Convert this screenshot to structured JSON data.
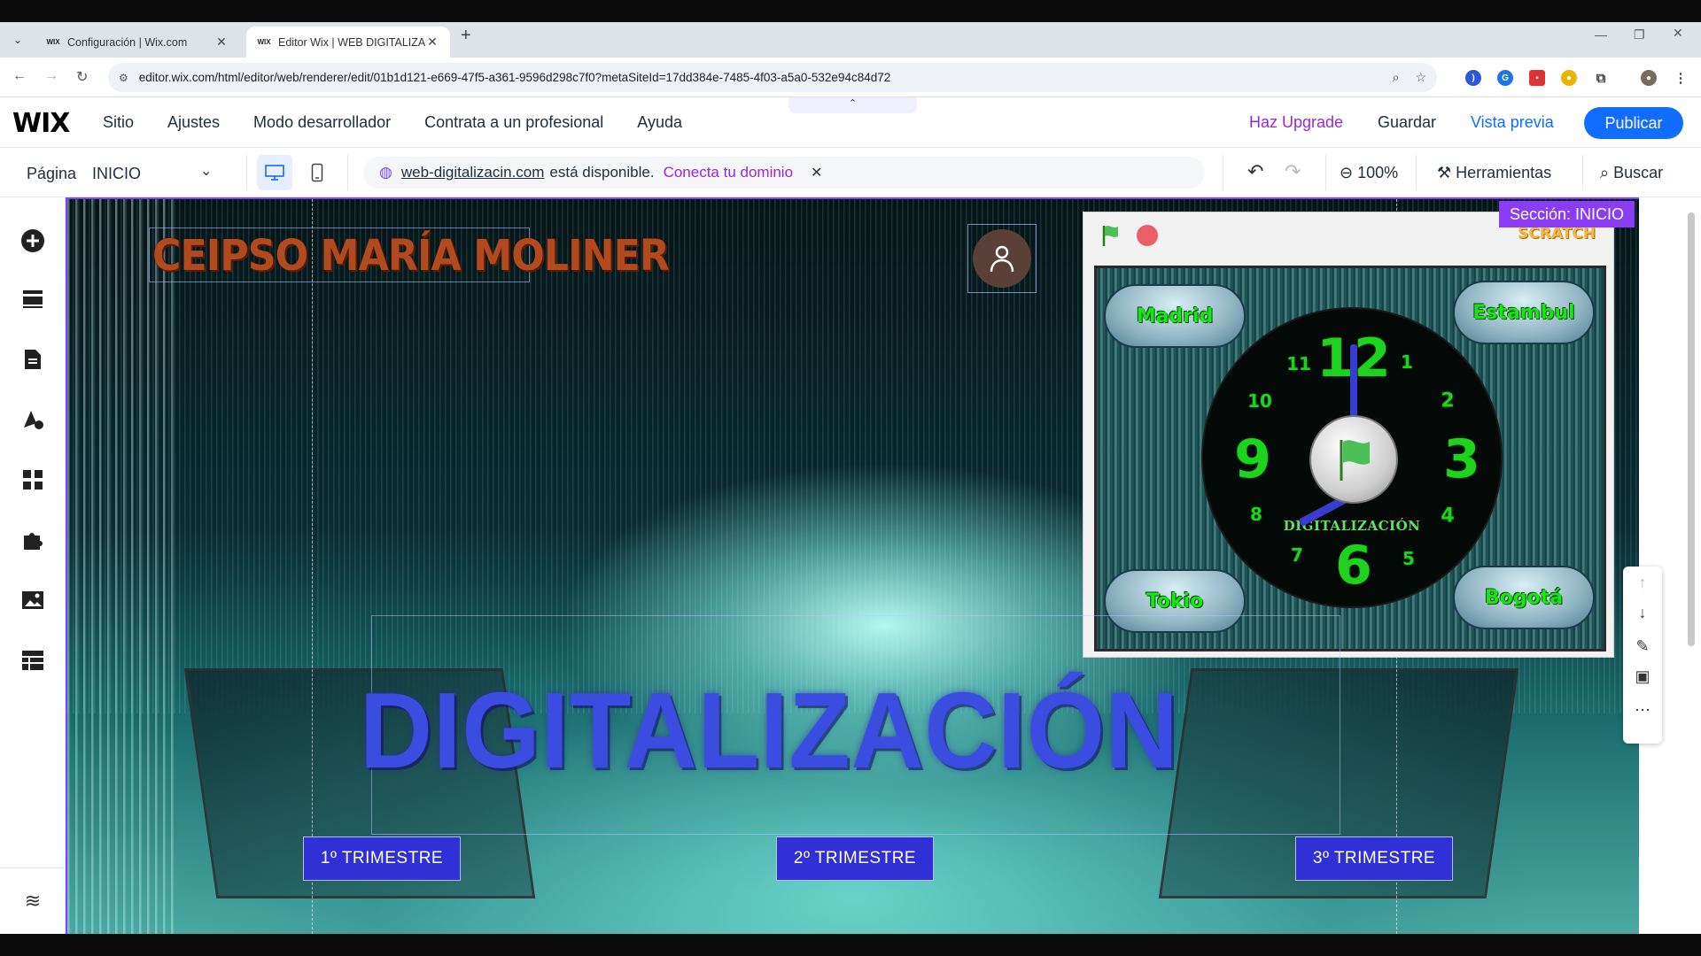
{
  "browser": {
    "tabs": [
      {
        "favicon": "WIX",
        "label": "Configuración | Wix.com"
      },
      {
        "favicon": "WIX",
        "label": "Editor Wix | WEB DIGITALIZACI"
      }
    ],
    "url": "editor.wix.com/html/editor/web/renderer/edit/01b1d121-e669-47f5-a361-9596d298c7f0?metaSiteId=17dd384e-7485-4f03-a5a0-532e94c84d72"
  },
  "wix_top": {
    "logo": "WIX",
    "menu": [
      "Sitio",
      "Ajustes",
      "Modo desarrollador",
      "Contrata a un profesional",
      "Ayuda"
    ],
    "upgrade": "Haz Upgrade",
    "save": "Guardar",
    "preview": "Vista previa",
    "publish": "Publicar"
  },
  "wix_sub": {
    "page_label": "Página",
    "page_value": "INICIO",
    "domain": "web-digitalizacin.com",
    "domain_status": "está disponible.",
    "connect": "Conecta tu dominio",
    "zoom": "100%",
    "tools": "Herramientas",
    "search": "Buscar"
  },
  "canvas": {
    "section_tag": "Sección: INICIO",
    "site_title": "CEIPSO MARÍA MOLINER",
    "headline": "DIGITALIZACIÓN",
    "buttons": [
      "1º TRIMESTRE",
      "2º TRIMESTRE",
      "3º TRIMESTRE"
    ],
    "scratch": {
      "logo": "SCRATCH",
      "cities": [
        "Madrid",
        "Estambul",
        "Tokio",
        "Bogotá"
      ],
      "clock_label": "DIGITALIZACIÓN",
      "clock_numbers": {
        "n12": "12",
        "n1": "1",
        "n2": "2",
        "n3": "3",
        "n4": "4",
        "n5": "5",
        "n6": "6",
        "n7": "7",
        "n8": "8",
        "n9": "9",
        "n10": "10",
        "n11": "11"
      }
    }
  },
  "colors": {
    "accent": "#116dff",
    "upgrade": "#9a27d5",
    "section": "#8a3cf7",
    "headline": "#3a4de0",
    "clock_digits": "#1ed31e"
  }
}
